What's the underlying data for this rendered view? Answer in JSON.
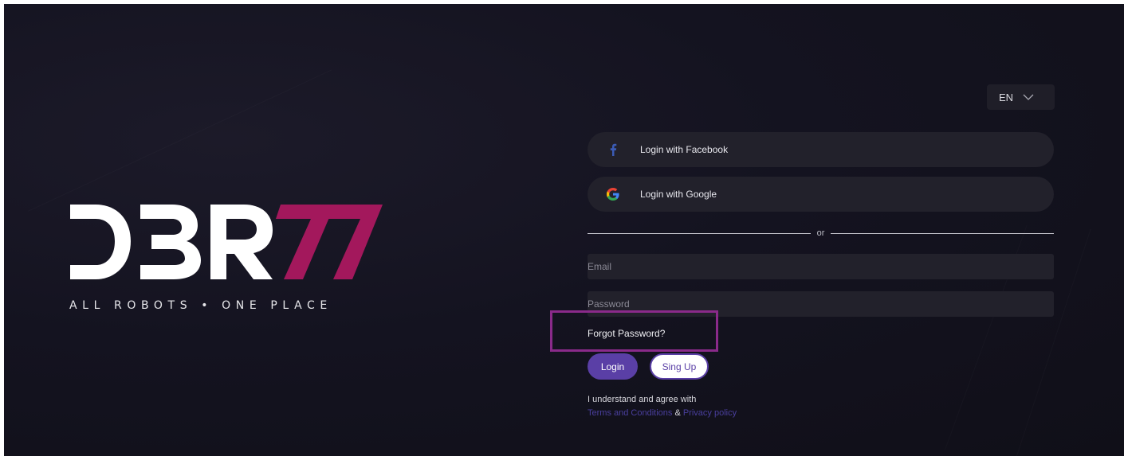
{
  "brand": {
    "logo_text_main": "DBR",
    "logo_text_accent": "77",
    "tagline": "ALL ROBOTS • ONE PLACE"
  },
  "language": {
    "selected": "EN",
    "icon": "chevron-down-icon"
  },
  "social": {
    "facebook_label": "Login with Facebook",
    "facebook_icon": "facebook-icon",
    "google_label": "Login with Google",
    "google_icon": "google-icon"
  },
  "divider_text": "or",
  "form": {
    "email_placeholder": "Email",
    "email_value": "",
    "password_placeholder": "Password",
    "password_value": "",
    "forgot_label": "Forgot Password?",
    "login_label": "Login",
    "signup_label": "Sing Up"
  },
  "agreement": {
    "text": "I understand and agree with",
    "terms_label": "Terms and Conditions",
    "amp": "&",
    "privacy_label": "Privacy policy"
  },
  "colors": {
    "background": "#141320",
    "accent_magenta": "#a3185c",
    "primary_button": "#5a3fa6",
    "highlight_box": "#8a2a8a",
    "link": "#4a3f9e"
  }
}
